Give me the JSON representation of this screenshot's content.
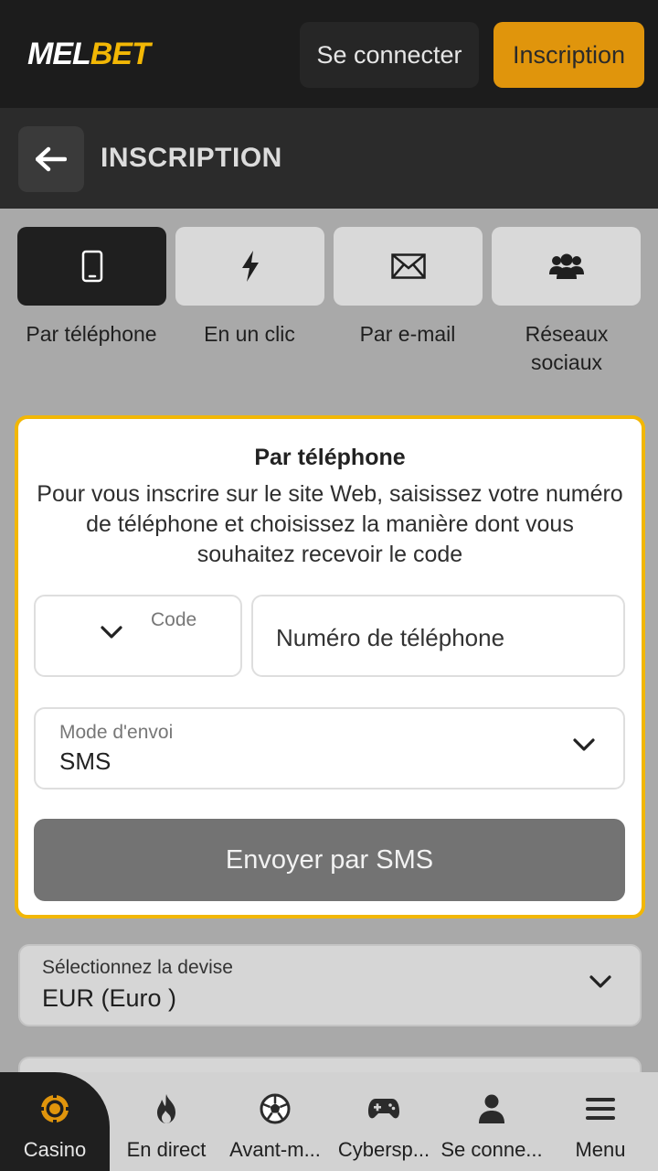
{
  "header": {
    "logo_part1": "MEL",
    "logo_part2": "BET",
    "login_label": "Se connecter",
    "register_label": "Inscription"
  },
  "titlebar": {
    "title": "INSCRIPTION"
  },
  "methods": [
    {
      "label": "Par téléphone",
      "icon": "phone-icon",
      "active": true
    },
    {
      "label": "En un clic",
      "icon": "lightning-icon",
      "active": false
    },
    {
      "label": "Par e-mail",
      "icon": "envelope-icon",
      "active": false
    },
    {
      "label": "Réseaux sociaux",
      "icon": "users-icon",
      "active": false
    }
  ],
  "form": {
    "title": "Par téléphone",
    "description": "Pour vous inscrire sur le site Web, saisissez votre numéro de téléphone et choisissez la manière dont vous souhaitez recevoir le code",
    "code_label": "Code",
    "phone_placeholder": "Numéro de téléphone",
    "mode_label": "Mode d'envoi",
    "mode_value": "SMS",
    "submit_label": "Envoyer par SMS"
  },
  "currency": {
    "label": "Sélectionnez la devise",
    "value": "EUR (Euro )"
  },
  "bottom_nav": [
    {
      "label": "Casino",
      "icon": "casino-chip-icon",
      "active": true
    },
    {
      "label": "En direct",
      "icon": "flame-icon",
      "active": false
    },
    {
      "label": "Avant-m...",
      "icon": "soccer-ball-icon",
      "active": false
    },
    {
      "label": "Cybersp...",
      "icon": "gamepad-icon",
      "active": false
    },
    {
      "label": "Se conne...",
      "icon": "user-icon",
      "active": false
    },
    {
      "label": "Menu",
      "icon": "hamburger-icon",
      "active": false
    }
  ],
  "colors": {
    "accent": "#f2b705",
    "register_button": "#e0950c",
    "header_bg": "#1c1c1c"
  }
}
